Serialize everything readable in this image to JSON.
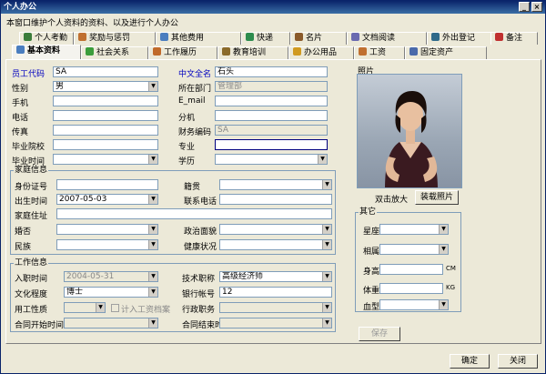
{
  "window": {
    "title": "个人办公",
    "description": "本窗口维护个人资料的资料、以及进行个人办公",
    "minimize": "_",
    "close": "×"
  },
  "top_tabs": [
    {
      "label": "个人考勤",
      "color": "#3b7d3b"
    },
    {
      "label": "奖励与惩罚",
      "color": "#c07030"
    },
    {
      "label": "其他费用",
      "color": "#4a7dbf"
    },
    {
      "label": "快递",
      "color": "#2d8c4e"
    },
    {
      "label": "名片",
      "color": "#8a5a2a"
    },
    {
      "label": "文档阅读",
      "color": "#6a6ab0"
    },
    {
      "label": "外出登记",
      "color": "#2f6a8a"
    },
    {
      "label": "备注",
      "color": "#c03030"
    }
  ],
  "sub_tabs": [
    {
      "label": "基本资料",
      "color": "#4a7dbf"
    },
    {
      "label": "社会关系",
      "color": "#3b9d3b"
    },
    {
      "label": "工作履历",
      "color": "#c06a2a"
    },
    {
      "label": "教育培训",
      "color": "#8a6a2a"
    },
    {
      "label": "办公用品",
      "color": "#d09a20"
    },
    {
      "label": "工资",
      "color": "#c07030"
    },
    {
      "label": "固定资产",
      "color": "#4a6aaa"
    }
  ],
  "basic": {
    "emp_code_label": "员工代码",
    "emp_code": "SA",
    "cn_name_label": "中文全名",
    "cn_name": "石头",
    "gender_label": "性别",
    "gender": "男",
    "dept_label": "所在部门",
    "dept": "管理部",
    "mobile_label": "手机",
    "mobile": "",
    "email_label": "E_mail",
    "email": "",
    "phone_label": "电话",
    "phone": "",
    "ext_label": "分机",
    "ext": "",
    "fax_label": "传真",
    "fax": "",
    "fin_code_label": "财务编码",
    "fin_code": "SA",
    "school_label": "毕业院校",
    "school": "",
    "major_label": "专业",
    "major": "",
    "grad_time_label": "毕业时间",
    "grad_time": "",
    "degree_label": "学历",
    "degree": ""
  },
  "family": {
    "title": "家庭信息",
    "id_label": "身份证号",
    "id": "",
    "origin_label": "籍贯",
    "origin": "",
    "birth_label": "出生时间",
    "birth": "2007-05-03",
    "contact_label": "联系电话",
    "contact": "",
    "address_label": "家庭住址",
    "address": "",
    "married_label": "婚否",
    "married": "",
    "political_label": "政治面貌",
    "political": "",
    "nation_label": "民族",
    "nation": "",
    "health_label": "健康状况",
    "health": ""
  },
  "work": {
    "title": "工作信息",
    "entry_label": "入职时间",
    "entry": "2004-05-31",
    "title_label": "技术职称",
    "job_title": "高级经济师",
    "edu_label": "文化程度",
    "edu": "博士",
    "bank_label": "银行帐号",
    "bank": "12",
    "emp_type_label": "用工性质",
    "emp_type": "",
    "payroll_label": "计入工资档案",
    "admin_label": "行政职务",
    "admin": "",
    "contract_start_label": "合同开始时间",
    "contract_start": "",
    "contract_end_label": "合同结束时",
    "contract_end": ""
  },
  "photo": {
    "label": "照片",
    "zoom_hint": "双击放大",
    "load_button": "装载照片"
  },
  "other": {
    "title": "其它",
    "zodiac_label": "星座",
    "zodiac": "",
    "animal_label": "相属",
    "animal": "",
    "height_label": "身高",
    "height": "",
    "height_unit": "CM",
    "weight_label": "体重",
    "weight": "",
    "weight_unit": "KG",
    "blood_label": "血型",
    "blood": ""
  },
  "buttons": {
    "save": "保存",
    "ok": "确定",
    "close": "关闭"
  }
}
